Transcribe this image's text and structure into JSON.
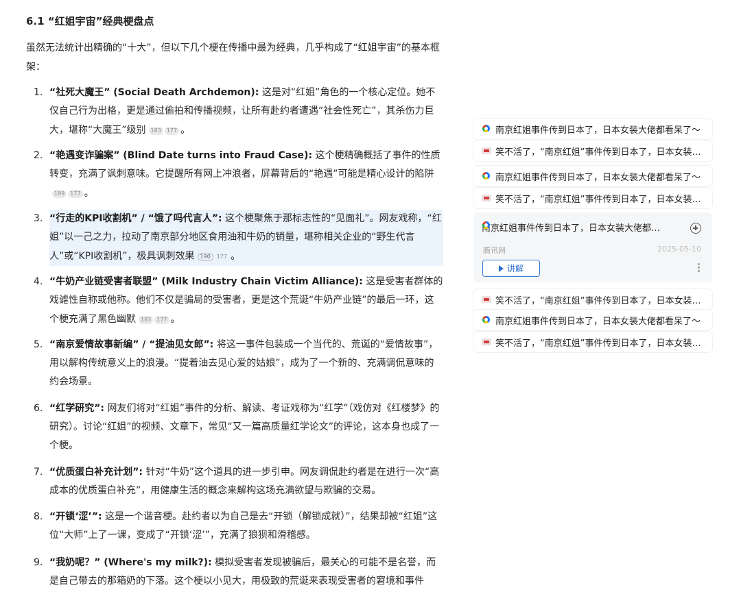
{
  "section": {
    "title": "6.1 “红姐宇宙”经典梗盘点",
    "intro": "虽然无法统计出精确的“十大”，但以下几个梗在传播中最为经典，几乎构成了“红姐宇宙”的基本框架："
  },
  "items": [
    {
      "num": "1.",
      "term": "“社死大魔王” (Social Death Archdemon):",
      "desc": " 这是对“红姐”角色的一个核心定位。她不仅自己行为出格，更是通过偷拍和传播视频，让所有赴约者遭遇“社会性死亡”，其杀伤力巨大，堪称“大魔王”级别",
      "cites": [
        "183",
        "177"
      ]
    },
    {
      "num": "2.",
      "term": "“艳遇变诈骗案” (Blind Date turns into Fraud Case):",
      "desc": " 这个梗精确概括了事件的性质转变，充满了讽刺意味。它提醒所有网上冲浪者，屏幕背后的“艳遇”可能是精心设计的陷阱",
      "cites": [
        "189",
        "177"
      ]
    },
    {
      "num": "3.",
      "term": "“行走的KPI收割机” / “饿了吗代言人”:",
      "desc": " 这个梗聚焦于那标志性的“见面礼”。网友戏称，“红姐”以一己之力，拉动了南京部分地区食用油和牛奶的销量，堪称相关企业的“野生代言人”或“KPI收割机”，极具讽刺效果",
      "cites": [
        "190",
        "177"
      ]
    },
    {
      "num": "4.",
      "term": "“牛奶产业链受害者联盟” (Milk Industry Chain Victim Alliance):",
      "desc": " 这是受害者群体的戏谑性自称或他称。他们不仅是骗局的受害者，更是这个荒诞“牛奶产业链”的最后一环，这个梗充满了黑色幽默",
      "cites": [
        "183",
        "177"
      ]
    },
    {
      "num": "5.",
      "term": "“南京爱情故事新编” / “提油见女郎”:",
      "desc": " 将这一事件包装成一个当代的、荒诞的“爱情故事”，用以解构传统意义上的浪漫。“提着油去见心爱的姑娘”，成为了一个新的、充满调侃意味的约会场景。",
      "cites": []
    },
    {
      "num": "6.",
      "term": "“红学研究”:",
      "desc": " 网友们将对“红姐”事件的分析、解读、考证戏称为“红学”（戏仿对《红楼梦》的研究）。讨论“红姐”的视频、文章下，常见“又一篇高质量红学论文”的评论，这本身也成了一个梗。",
      "cites": []
    },
    {
      "num": "7.",
      "term": "“优质蛋白补充计划”:",
      "desc": " 针对“牛奶”这个道具的进一步引申。网友调侃赴约者是在进行一次“高成本的优质蛋白补充”，用健康生活的概念来解构这场充满欲望与欺骗的交易。",
      "cites": []
    },
    {
      "num": "8.",
      "term": "“开锁‘涩’”:",
      "desc": " 这是一个谐音梗。赴约者以为自己是去“开锁（解锁成就）”，结果却被“红姐”这位“大师”上了一课，变成了“开锁‘涩’”，充满了狼狈和滑稽感。",
      "cites": []
    },
    {
      "num": "9.",
      "term": "“我奶呢？” (Where's my milk?):",
      "desc": " 模拟受害者发现被骗后，最关心的可能不是名誉，而是自己带去的那箱奶的下落。这个梗以小见大，用极致的荒诞来表现受害者的窘境和事件",
      "cites": []
    }
  ],
  "sources": {
    "list_top": [
      {
        "icon": "tencent-news-icon",
        "title": "南京红姐事件传到日本了，日本女装大佬都看呆了～"
      },
      {
        "icon": "netease-news-icon",
        "title": "笑不活了，“南京红姐”事件传到日本了，日本女装大佬都看呆了"
      },
      {
        "icon": "tencent-news-icon",
        "title": "南京红姐事件传到日本了，日本女装大佬都看呆了～"
      },
      {
        "icon": "netease-news-icon",
        "title": "笑不活了，“南京红姐”事件传到日本了，日本女装大佬都看呆了"
      }
    ],
    "card": {
      "icon": "tencent-news-icon",
      "title": "南京红姐事件传到日本了，日本女装大佬都看呆了～",
      "site": "腾讯网",
      "date": "2025-05-10",
      "explain_label": "讲解"
    },
    "list_bottom": [
      {
        "icon": "netease-news-icon",
        "title": "笑不活了，“南京红姐”事件传到日本了，日本女装大佬都看呆了"
      },
      {
        "icon": "tencent-news-icon",
        "title": "南京红姐事件传到日本了，日本女装大佬都看呆了～"
      },
      {
        "icon": "netease-news-icon",
        "title": "笑不活了，“南京红姐”事件传到日本了，日本女装大佬都看呆了"
      }
    ]
  }
}
